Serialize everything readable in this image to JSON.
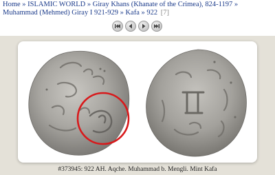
{
  "breadcrumb": {
    "items": [
      {
        "label": "Home"
      },
      {
        "label": "ISLAMIC WORLD"
      },
      {
        "label": "Giray Khans (Khanate of the Crimea), 824-1197"
      },
      {
        "label": "Muhammad (Mehmed) Giray I 921-929"
      },
      {
        "label": "Kafa"
      },
      {
        "label": "922"
      }
    ],
    "separator": "»",
    "count": "[7]"
  },
  "nav": {
    "first_icon": "first-page-icon",
    "prev_icon": "previous-icon",
    "next_icon": "next-icon",
    "last_icon": "last-page-icon"
  },
  "image": {
    "caption": "#373945: 922 AH. Aqche. Muhammad b. Mengli. Mint Kafa",
    "highlight_color": "#d8191b"
  }
}
